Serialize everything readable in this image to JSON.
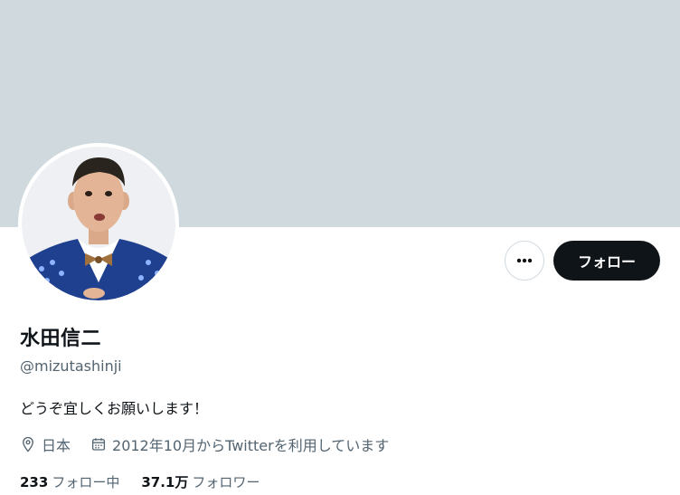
{
  "profile": {
    "display_name": "水田信二",
    "handle": "@mizutashinji",
    "bio": "どうぞ宜しくお願いします！",
    "location": "日本",
    "joined": "2012年10月からTwitterを利用しています"
  },
  "actions": {
    "more_icon": "ellipsis-icon",
    "follow_label": "フォロー"
  },
  "stats": {
    "following_count": "233",
    "following_label": "フォロー中",
    "followers_count": "37.1万",
    "followers_label": "フォロワー"
  },
  "colors": {
    "banner": "#cfd9de",
    "primary_text": "#0f1419",
    "secondary_text": "#536471",
    "follow_button": "#0f1419"
  }
}
